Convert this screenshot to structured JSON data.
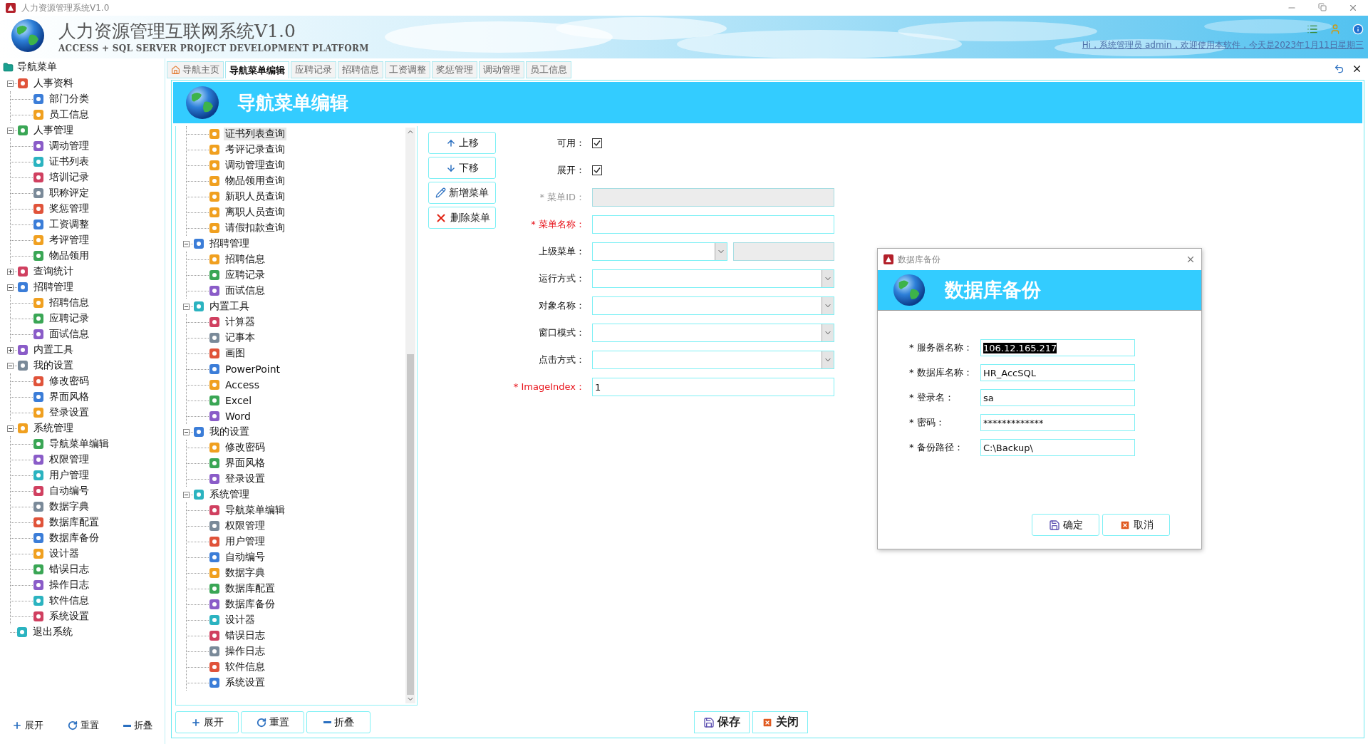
{
  "window": {
    "title": "人力资源管理系统V1.0"
  },
  "header": {
    "title": "人力资源管理互联网系统V1.0",
    "subtitle": "ACCESS + SQL SERVER PROJECT DEVELOPMENT PLATFORM",
    "greeting": "Hi，系统管理员 admin，欢迎使用本软件，今天是2023年1月11日星期三"
  },
  "sidebar": {
    "title": "导航菜单",
    "tree": [
      {
        "label": "人事资料",
        "expanded": true,
        "children": [
          {
            "label": "部门分类"
          },
          {
            "label": "员工信息"
          }
        ]
      },
      {
        "label": "人事管理",
        "expanded": true,
        "children": [
          {
            "label": "调动管理"
          },
          {
            "label": "证书列表"
          },
          {
            "label": "培训记录"
          },
          {
            "label": "职称评定"
          },
          {
            "label": "奖惩管理"
          },
          {
            "label": "工资调整"
          },
          {
            "label": "考评管理"
          },
          {
            "label": "物品领用"
          }
        ]
      },
      {
        "label": "查询统计",
        "expanded": false
      },
      {
        "label": "招聘管理",
        "expanded": true,
        "children": [
          {
            "label": "招聘信息"
          },
          {
            "label": "应聘记录"
          },
          {
            "label": "面试信息"
          }
        ]
      },
      {
        "label": "内置工具",
        "expanded": false
      },
      {
        "label": "我的设置",
        "expanded": true,
        "children": [
          {
            "label": "修改密码"
          },
          {
            "label": "界面风格"
          },
          {
            "label": "登录设置"
          }
        ]
      },
      {
        "label": "系统管理",
        "expanded": true,
        "children": [
          {
            "label": "导航菜单编辑"
          },
          {
            "label": "权限管理"
          },
          {
            "label": "用户管理"
          },
          {
            "label": "自动编号"
          },
          {
            "label": "数据字典"
          },
          {
            "label": "数据库配置"
          },
          {
            "label": "数据库备份"
          },
          {
            "label": "设计器"
          },
          {
            "label": "错误日志"
          },
          {
            "label": "操作日志"
          },
          {
            "label": "软件信息"
          },
          {
            "label": "系统设置"
          }
        ]
      },
      {
        "label": "退出系统"
      }
    ],
    "buttons": [
      {
        "label": "展开",
        "kind": "expand"
      },
      {
        "label": "重置",
        "kind": "reset"
      },
      {
        "label": "折叠",
        "kind": "collapse"
      }
    ]
  },
  "tabs": [
    {
      "label": "导航主页",
      "kind": "home",
      "selected": false
    },
    {
      "label": "导航菜单编辑",
      "kind": "page",
      "selected": true
    },
    {
      "label": "应聘记录",
      "kind": "page",
      "selected": false
    },
    {
      "label": "招聘信息",
      "kind": "page",
      "selected": false
    },
    {
      "label": "工资调整",
      "kind": "page",
      "selected": false
    },
    {
      "label": "奖惩管理",
      "kind": "page",
      "selected": false
    },
    {
      "label": "调动管理",
      "kind": "page",
      "selected": false
    },
    {
      "label": "员工信息",
      "kind": "page",
      "selected": false
    }
  ],
  "panel": {
    "title": "导航菜单编辑"
  },
  "menu_tree": {
    "leading_items": [
      {
        "label": "证书列表查询",
        "selected": true
      },
      {
        "label": "考评记录查询",
        "selected": false
      },
      {
        "label": "调动管理查询",
        "selected": false
      },
      {
        "label": "物品领用查询",
        "selected": false
      },
      {
        "label": "新职人员查询",
        "selected": false
      },
      {
        "label": "离职人员查询",
        "selected": false
      },
      {
        "label": "请假扣款查询",
        "selected": false
      }
    ],
    "items": [
      {
        "label": "招聘管理",
        "expanded": true,
        "selected": false,
        "children": [
          {
            "label": "招聘信息",
            "selected": false
          },
          {
            "label": "应聘记录",
            "selected": false
          },
          {
            "label": "面试信息",
            "selected": false
          }
        ]
      },
      {
        "label": "内置工具",
        "expanded": true,
        "selected": false,
        "children": [
          {
            "label": "计算器",
            "selected": false
          },
          {
            "label": "记事本",
            "selected": false
          },
          {
            "label": "画图",
            "selected": false
          },
          {
            "label": "PowerPoint",
            "selected": false
          },
          {
            "label": "Access",
            "selected": false
          },
          {
            "label": "Excel",
            "selected": false
          },
          {
            "label": "Word",
            "selected": false
          }
        ]
      },
      {
        "label": "我的设置",
        "expanded": true,
        "selected": false,
        "children": [
          {
            "label": "修改密码",
            "selected": false
          },
          {
            "label": "界面风格",
            "selected": false
          },
          {
            "label": "登录设置",
            "selected": false
          }
        ]
      },
      {
        "label": "系统管理",
        "expanded": true,
        "selected": false,
        "children": [
          {
            "label": "导航菜单编辑",
            "selected": false
          },
          {
            "label": "权限管理",
            "selected": false
          },
          {
            "label": "用户管理",
            "selected": false
          },
          {
            "label": "自动编号",
            "selected": false
          },
          {
            "label": "数据字典",
            "selected": false
          },
          {
            "label": "数据库配置",
            "selected": false
          },
          {
            "label": "数据库备份",
            "selected": false
          },
          {
            "label": "设计器",
            "selected": false
          },
          {
            "label": "错误日志",
            "selected": false
          },
          {
            "label": "操作日志",
            "selected": false
          },
          {
            "label": "软件信息",
            "selected": false
          },
          {
            "label": "系统设置",
            "selected": false
          }
        ]
      }
    ],
    "buttons": [
      {
        "label": "展开",
        "kind": "expand"
      },
      {
        "label": "重置",
        "kind": "reset"
      },
      {
        "label": "折叠",
        "kind": "collapse"
      }
    ]
  },
  "actions": [
    {
      "label": "上移",
      "kind": "up"
    },
    {
      "label": "下移",
      "kind": "down"
    },
    {
      "label": "新增菜单",
      "kind": "add"
    },
    {
      "label": "删除菜单",
      "kind": "delete"
    }
  ],
  "form": [
    {
      "kind": "checkbox",
      "label": "可用：",
      "checked": true
    },
    {
      "kind": "checkbox",
      "label": "展开：",
      "checked": true
    },
    {
      "kind": "text",
      "label": "* 菜单ID：",
      "disabled": true,
      "required": false
    },
    {
      "kind": "text",
      "label": "* 菜单名称：",
      "disabled": false,
      "required": true
    },
    {
      "kind": "combo_text",
      "label": "上级菜单：",
      "disabled": false,
      "required": false
    },
    {
      "kind": "combo",
      "label": "运行方式：",
      "disabled": false,
      "required": false
    },
    {
      "kind": "combo",
      "label": "对象名称：",
      "disabled": false,
      "required": false
    },
    {
      "kind": "combo",
      "label": "窗口模式：",
      "disabled": false,
      "required": false
    },
    {
      "kind": "combo",
      "label": "点击方式：",
      "disabled": false,
      "required": false
    },
    {
      "kind": "text",
      "label": "* ImageIndex：",
      "value": "1",
      "disabled": false,
      "required": true
    }
  ],
  "footer_buttons": [
    {
      "label": "保存",
      "kind": "save"
    },
    {
      "label": "关闭",
      "kind": "close"
    }
  ],
  "dialog": {
    "title": "数据库备份",
    "heading": "数据库备份",
    "fields": [
      {
        "label": "* 服务器名称：",
        "value": "106.12.165.217",
        "highlighted": true
      },
      {
        "label": "* 数据库名称：",
        "value": "HR_AccSQL",
        "highlighted": false
      },
      {
        "label": "* 登录名：",
        "value": "sa",
        "highlighted": false
      },
      {
        "label": "* 密码：",
        "value": "*************",
        "highlighted": false
      },
      {
        "label": "* 备份路径：",
        "value": "C:\\Backup\\",
        "highlighted": false
      }
    ],
    "buttons": [
      {
        "label": "确定",
        "kind": "ok"
      },
      {
        "label": "取消",
        "kind": "cancel"
      }
    ]
  }
}
